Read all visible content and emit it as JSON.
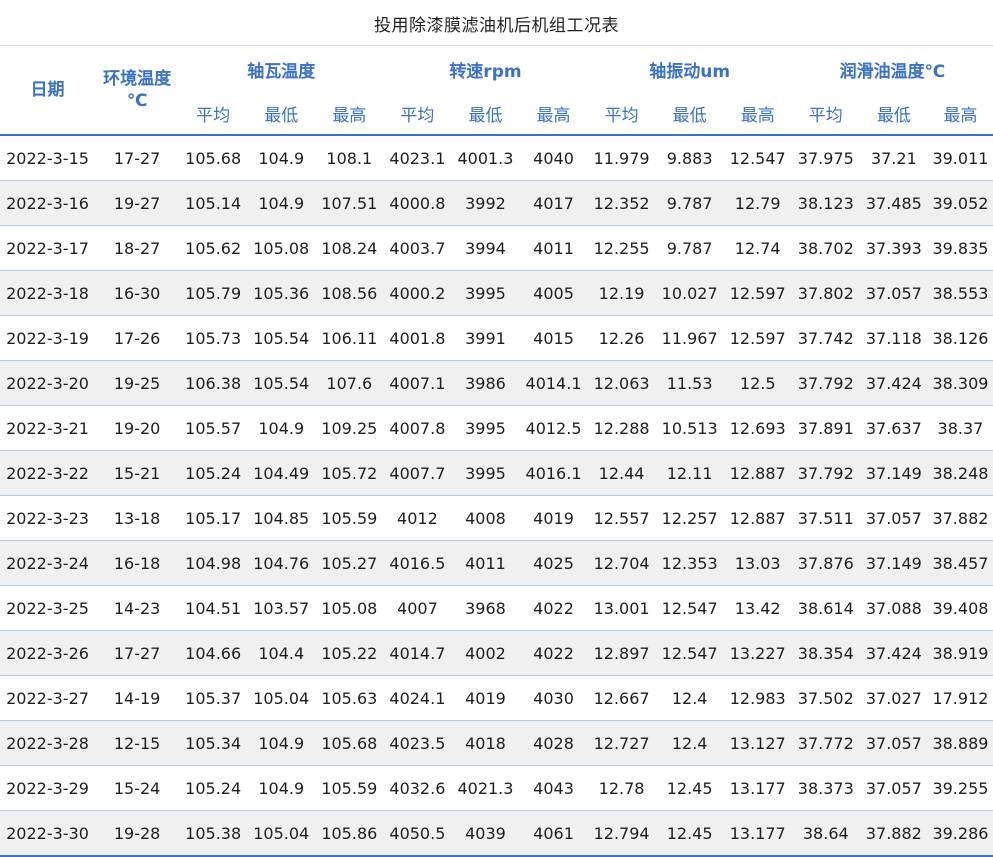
{
  "title": "投用除漆膜滤油机后机组工况表",
  "headers": {
    "date": "日期",
    "env_temp_line1": "环境温度",
    "env_temp_line2": "℃",
    "groups": [
      "轴瓦温度",
      "转速rpm",
      "轴振动um",
      "润滑油温度℃"
    ],
    "sub": [
      "平均",
      "最低",
      "最高"
    ]
  },
  "rows": [
    [
      "2022-3-15",
      "17-27",
      "105.68",
      "104.9",
      "108.1",
      "4023.1",
      "4001.3",
      "4040",
      "11.979",
      "9.883",
      "12.547",
      "37.975",
      "37.21",
      "39.011"
    ],
    [
      "2022-3-16",
      "19-27",
      "105.14",
      "104.9",
      "107.51",
      "4000.8",
      "3992",
      "4017",
      "12.352",
      "9.787",
      "12.79",
      "38.123",
      "37.485",
      "39.052"
    ],
    [
      "2022-3-17",
      "18-27",
      "105.62",
      "105.08",
      "108.24",
      "4003.7",
      "3994",
      "4011",
      "12.255",
      "9.787",
      "12.74",
      "38.702",
      "37.393",
      "39.835"
    ],
    [
      "2022-3-18",
      "16-30",
      "105.79",
      "105.36",
      "108.56",
      "4000.2",
      "3995",
      "4005",
      "12.19",
      "10.027",
      "12.597",
      "37.802",
      "37.057",
      "38.553"
    ],
    [
      "2022-3-19",
      "17-26",
      "105.73",
      "105.54",
      "106.11",
      "4001.8",
      "3991",
      "4015",
      "12.26",
      "11.967",
      "12.597",
      "37.742",
      "37.118",
      "38.126"
    ],
    [
      "2022-3-20",
      "19-25",
      "106.38",
      "105.54",
      "107.6",
      "4007.1",
      "3986",
      "4014.1",
      "12.063",
      "11.53",
      "12.5",
      "37.792",
      "37.424",
      "38.309"
    ],
    [
      "2022-3-21",
      "19-20",
      "105.57",
      "104.9",
      "109.25",
      "4007.8",
      "3995",
      "4012.5",
      "12.288",
      "10.513",
      "12.693",
      "37.891",
      "37.637",
      "38.37"
    ],
    [
      "2022-3-22",
      "15-21",
      "105.24",
      "104.49",
      "105.72",
      "4007.7",
      "3995",
      "4016.1",
      "12.44",
      "12.11",
      "12.887",
      "37.792",
      "37.149",
      "38.248"
    ],
    [
      "2022-3-23",
      "13-18",
      "105.17",
      "104.85",
      "105.59",
      "4012",
      "4008",
      "4019",
      "12.557",
      "12.257",
      "12.887",
      "37.511",
      "37.057",
      "37.882"
    ],
    [
      "2022-3-24",
      "16-18",
      "104.98",
      "104.76",
      "105.27",
      "4016.5",
      "4011",
      "4025",
      "12.704",
      "12.353",
      "13.03",
      "37.876",
      "37.149",
      "38.457"
    ],
    [
      "2022-3-25",
      "14-23",
      "104.51",
      "103.57",
      "105.08",
      "4007",
      "3968",
      "4022",
      "13.001",
      "12.547",
      "13.42",
      "38.614",
      "37.088",
      "39.408"
    ],
    [
      "2022-3-26",
      "17-27",
      "104.66",
      "104.4",
      "105.22",
      "4014.7",
      "4002",
      "4022",
      "12.897",
      "12.547",
      "13.227",
      "38.354",
      "37.424",
      "38.919"
    ],
    [
      "2022-3-27",
      "14-19",
      "105.37",
      "105.04",
      "105.63",
      "4024.1",
      "4019",
      "4030",
      "12.667",
      "12.4",
      "12.983",
      "37.502",
      "37.027",
      "17.912"
    ],
    [
      "2022-3-28",
      "12-15",
      "105.34",
      "104.9",
      "105.68",
      "4023.5",
      "4018",
      "4028",
      "12.727",
      "12.4",
      "13.127",
      "37.772",
      "37.057",
      "38.889"
    ],
    [
      "2022-3-29",
      "15-24",
      "105.24",
      "104.9",
      "105.59",
      "4032.6",
      "4021.3",
      "4043",
      "12.78",
      "12.45",
      "13.177",
      "38.373",
      "37.057",
      "39.255"
    ],
    [
      "2022-3-30",
      "19-28",
      "105.38",
      "105.04",
      "105.86",
      "4050.5",
      "4039",
      "4061",
      "12.794",
      "12.45",
      "13.177",
      "38.64",
      "37.882",
      "39.286"
    ]
  ]
}
